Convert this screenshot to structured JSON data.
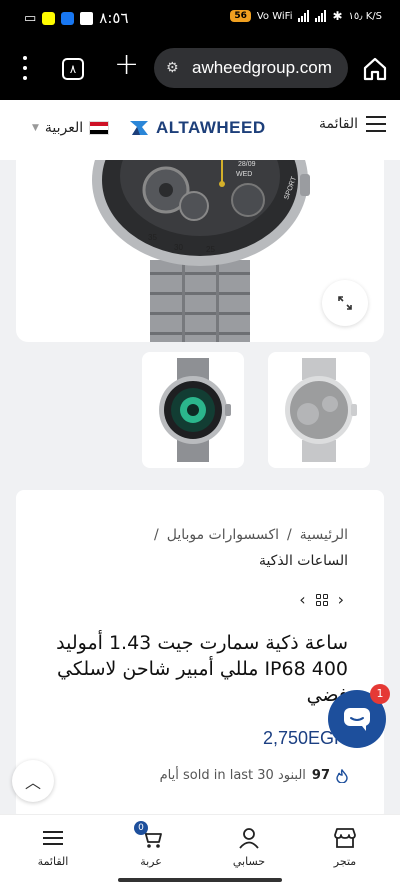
{
  "status_bar": {
    "battery": "56",
    "network": "Vo WiFi",
    "wifi_label": "WiFi",
    "speed": "١٥٫ K/S",
    "time": "٨:٥٦"
  },
  "browser": {
    "tab_count": "٨",
    "url": "awheedgroup.com"
  },
  "header": {
    "menu_label": "القائمة",
    "logo_text": "ALTAWHEED",
    "language_label": "العربية",
    "brand_color": "#1d3f7a"
  },
  "watch_image": {
    "date_text": "28/09",
    "day_text": "WED",
    "sport_text": "SPORT",
    "bezel_numbers": [
      "35",
      "30",
      "25"
    ]
  },
  "product": {
    "breadcrumb": [
      {
        "label": "الرئيسية"
      },
      {
        "label": "اكسسوارات موبايل"
      },
      {
        "label": "الساعات الذكية"
      }
    ],
    "title": "ساعة ذكية سمارت جيت 1.43 أموليد IP68 400 مللي أمبير شاحن لاسلكي فضي",
    "price": "2,750EGP",
    "sold_count": "97",
    "sold_text": "البنود sold in last 30 أيام"
  },
  "chat": {
    "badge": "1"
  },
  "bottom_nav": {
    "items": [
      {
        "label": "متجر",
        "icon": "store-icon"
      },
      {
        "label": "حسابي",
        "icon": "user-icon"
      },
      {
        "label": "عربة",
        "icon": "cart-icon",
        "badge": "0"
      },
      {
        "label": "القائمة",
        "icon": "menu-icon"
      }
    ]
  },
  "colors": {
    "accent": "#1d4f9c",
    "price": "#1b3f82",
    "badge_red": "#e53935"
  }
}
